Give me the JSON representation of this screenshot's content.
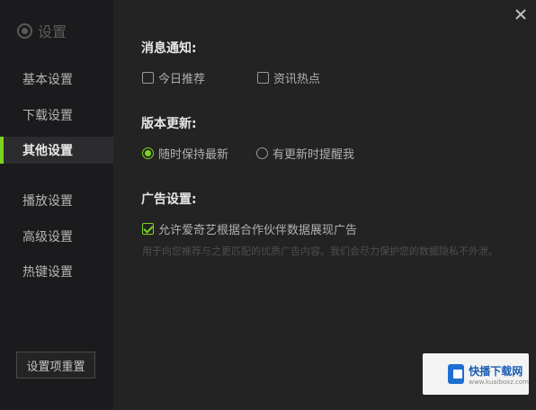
{
  "brand": {
    "title": "设置",
    "icon": "gear-icon"
  },
  "sidebar": {
    "items": [
      {
        "label": "基本设置",
        "active": false
      },
      {
        "label": "下载设置",
        "active": false
      },
      {
        "label": "其他设置",
        "active": true
      },
      {
        "label": "播放设置",
        "active": false
      },
      {
        "label": "高级设置",
        "active": false
      },
      {
        "label": "热键设置",
        "active": false
      }
    ],
    "reset_label": "设置项重置"
  },
  "sections": {
    "notify": {
      "title": "消息通知:",
      "options": [
        {
          "label": "今日推荐",
          "checked": false
        },
        {
          "label": "资讯热点",
          "checked": false
        }
      ]
    },
    "update": {
      "title": "版本更新:",
      "options": [
        {
          "label": "随时保持最新",
          "selected": true
        },
        {
          "label": "有更新时提醒我",
          "selected": false
        }
      ]
    },
    "ads": {
      "title": "广告设置:",
      "option": {
        "label": "允许爱奇艺根据合作伙伴数据展现广告",
        "checked": true
      },
      "note": "用于向您推荐与之更匹配的优质广告内容。我们会尽力保护您的数据隐私不外泄。"
    }
  },
  "watermark": {
    "title": "快播下载网",
    "subtitle": "www.kuaiboxz.com"
  },
  "colors": {
    "accent": "#7ed321",
    "background": "#232323",
    "sidebar": "#1b1b1d"
  }
}
